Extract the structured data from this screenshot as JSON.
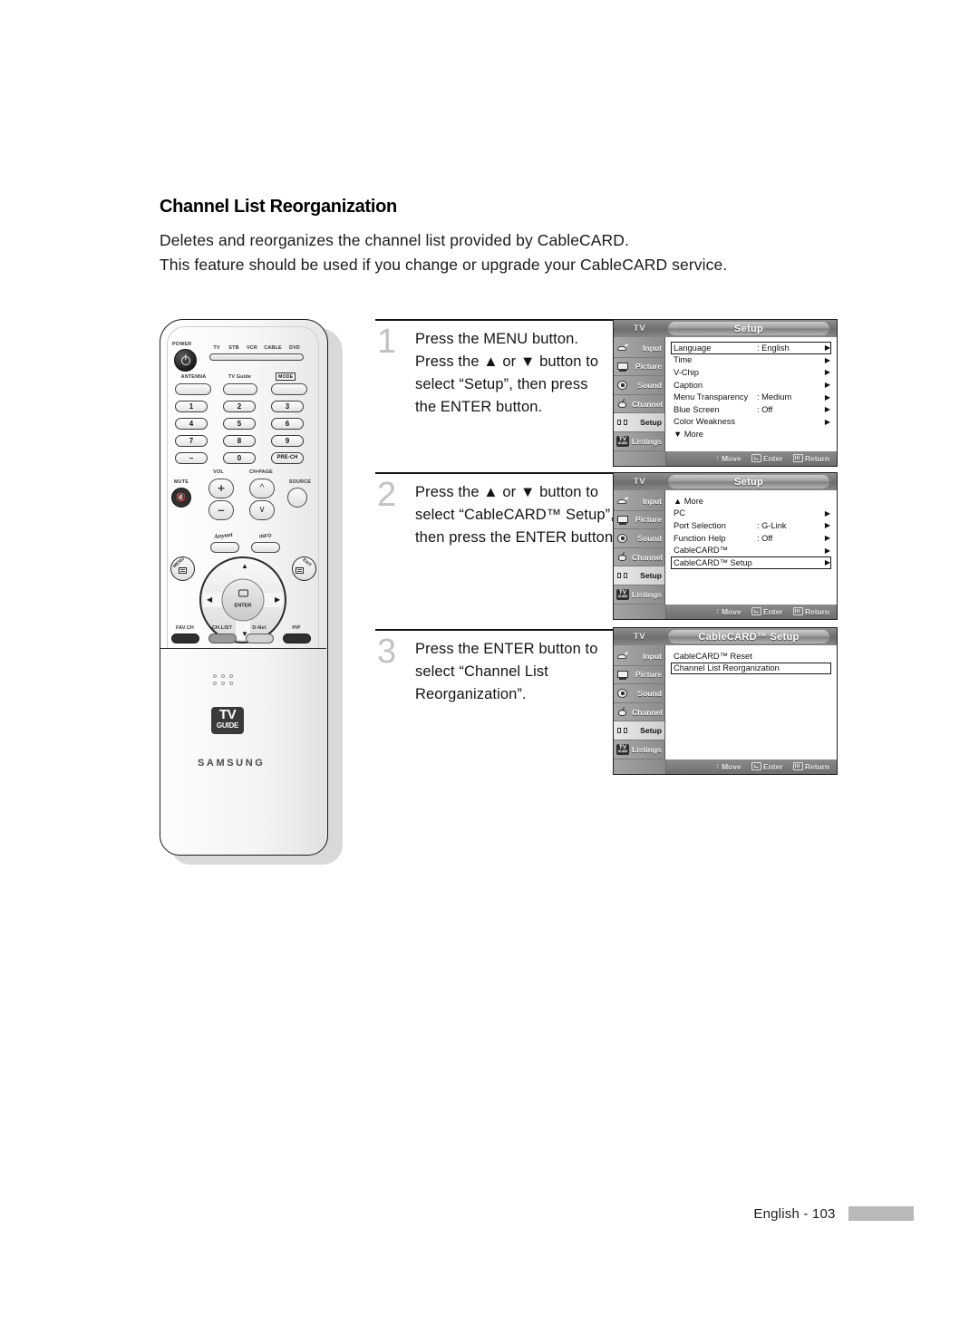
{
  "page": {
    "heading": "Channel List Reorganization",
    "intro_lines": [
      "Deletes and reorganizes the channel list provided by CableCARD.",
      "This feature should be used if you change or upgrade your CableCARD service."
    ],
    "footer_label": "English - 103"
  },
  "steps": [
    {
      "number": "1",
      "lines": [
        "Press the MENU button.",
        "Press the ▲ or ▼ button to",
        "select “Setup”, then press",
        "the ENTER button."
      ]
    },
    {
      "number": "2",
      "lines": [
        "Press the ▲ or ▼ button to",
        "select “CableCARD™ Setup”,",
        "then press the ENTER button."
      ]
    },
    {
      "number": "3",
      "lines": [
        "Press the ENTER button to",
        "select “Channel List",
        "Reorganization”."
      ]
    }
  ],
  "osd_common": {
    "tv_label": "TV",
    "sidebar": [
      {
        "label": "Input",
        "icon": "input-icon",
        "active": false
      },
      {
        "label": "Picture",
        "icon": "picture-icon",
        "active": false
      },
      {
        "label": "Sound",
        "icon": "sound-icon",
        "active": false
      },
      {
        "label": "Channel",
        "icon": "channel-icon",
        "active": false
      },
      {
        "label": "Setup",
        "icon": "setup-icon",
        "active": true
      },
      {
        "label": "Listings",
        "icon": "tvguide-icon",
        "active": false
      }
    ],
    "footer": {
      "move": "Move",
      "enter": "Enter",
      "return": "Return"
    }
  },
  "osd_panels": [
    {
      "title": "Setup",
      "title_tm": false,
      "rows": [
        {
          "label": "Language",
          "value": ": English",
          "arrow": true,
          "selected": true
        },
        {
          "label": "Time",
          "value": "",
          "arrow": true,
          "selected": false
        },
        {
          "label": "V-Chip",
          "value": "",
          "arrow": true,
          "selected": false
        },
        {
          "label": "Caption",
          "value": "",
          "arrow": true,
          "selected": false
        },
        {
          "label": "Menu Transparency",
          "value": ": Medium",
          "arrow": true,
          "selected": false
        },
        {
          "label": "Blue Screen",
          "value": ": Off",
          "arrow": true,
          "selected": false
        },
        {
          "label": "Color Weakness",
          "value": "",
          "arrow": true,
          "selected": false
        },
        {
          "label": "▼ More",
          "value": "",
          "arrow": false,
          "selected": false
        }
      ]
    },
    {
      "title": "Setup",
      "title_tm": false,
      "rows": [
        {
          "label": "▲ More",
          "value": "",
          "arrow": false,
          "selected": false
        },
        {
          "label": "PC",
          "value": "",
          "arrow": true,
          "selected": false
        },
        {
          "label": "Port Selection",
          "value": ": G-Link",
          "arrow": true,
          "selected": false
        },
        {
          "label": "Function Help",
          "value": ": Off",
          "arrow": true,
          "selected": false
        },
        {
          "label": "CableCARD™",
          "value": "",
          "arrow": true,
          "selected": false
        },
        {
          "label": "CableCARD™ Setup",
          "value": "",
          "arrow": true,
          "selected": true
        }
      ]
    },
    {
      "title": "CableCARD™ Setup",
      "title_tm": true,
      "rows": [
        {
          "label": "CableCARD™ Reset",
          "value": "",
          "arrow": false,
          "selected": false
        },
        {
          "label": "Channel List Reorganization",
          "value": "",
          "arrow": false,
          "selected": true
        }
      ]
    }
  ],
  "remote": {
    "power_label": "POWER",
    "device_modes": [
      "TV",
      "STB",
      "VCR",
      "CABLE",
      "DVD"
    ],
    "row_labels": [
      "ANTENNA",
      "TV Guide",
      "MODE"
    ],
    "numbers": [
      "1",
      "2",
      "3",
      "4",
      "5",
      "6",
      "7",
      "8",
      "9",
      "–",
      "0",
      "PRE-CH"
    ],
    "vol_label": "VOL",
    "ch_label": "CH•PAGE",
    "mute_label": "MUTE",
    "source_label": "SOURCE",
    "anynet_label": "Anynet",
    "info_label": "INFO",
    "menu_label": "MENU",
    "exit_label": "EXIT",
    "enter_label": "ENTER",
    "bottom_buttons": [
      "FAV.CH",
      "CH.LIST",
      "D-Net",
      "PIP"
    ],
    "tvguide_logo_top": "TV",
    "tvguide_logo_bottom": "GUIDE",
    "brand": "SAMSUNG"
  }
}
